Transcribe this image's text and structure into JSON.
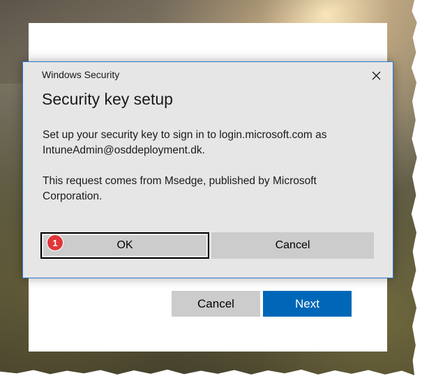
{
  "dialog": {
    "caption": "Windows Security",
    "title": "Security key setup",
    "body_line_1": "Set up your security key to sign in to login.microsoft.com as IntuneAdmin@osddeployment.dk.",
    "body_line_2": "This request comes from Msedge, published by Microsoft Corporation.",
    "ok_label": "OK",
    "cancel_label": "Cancel",
    "close_icon": "close-icon"
  },
  "annotation": {
    "step_number": "1",
    "color": "#e0373a"
  },
  "page": {
    "cancel_label": "Cancel",
    "next_label": "Next",
    "accent": "#0067b8"
  }
}
